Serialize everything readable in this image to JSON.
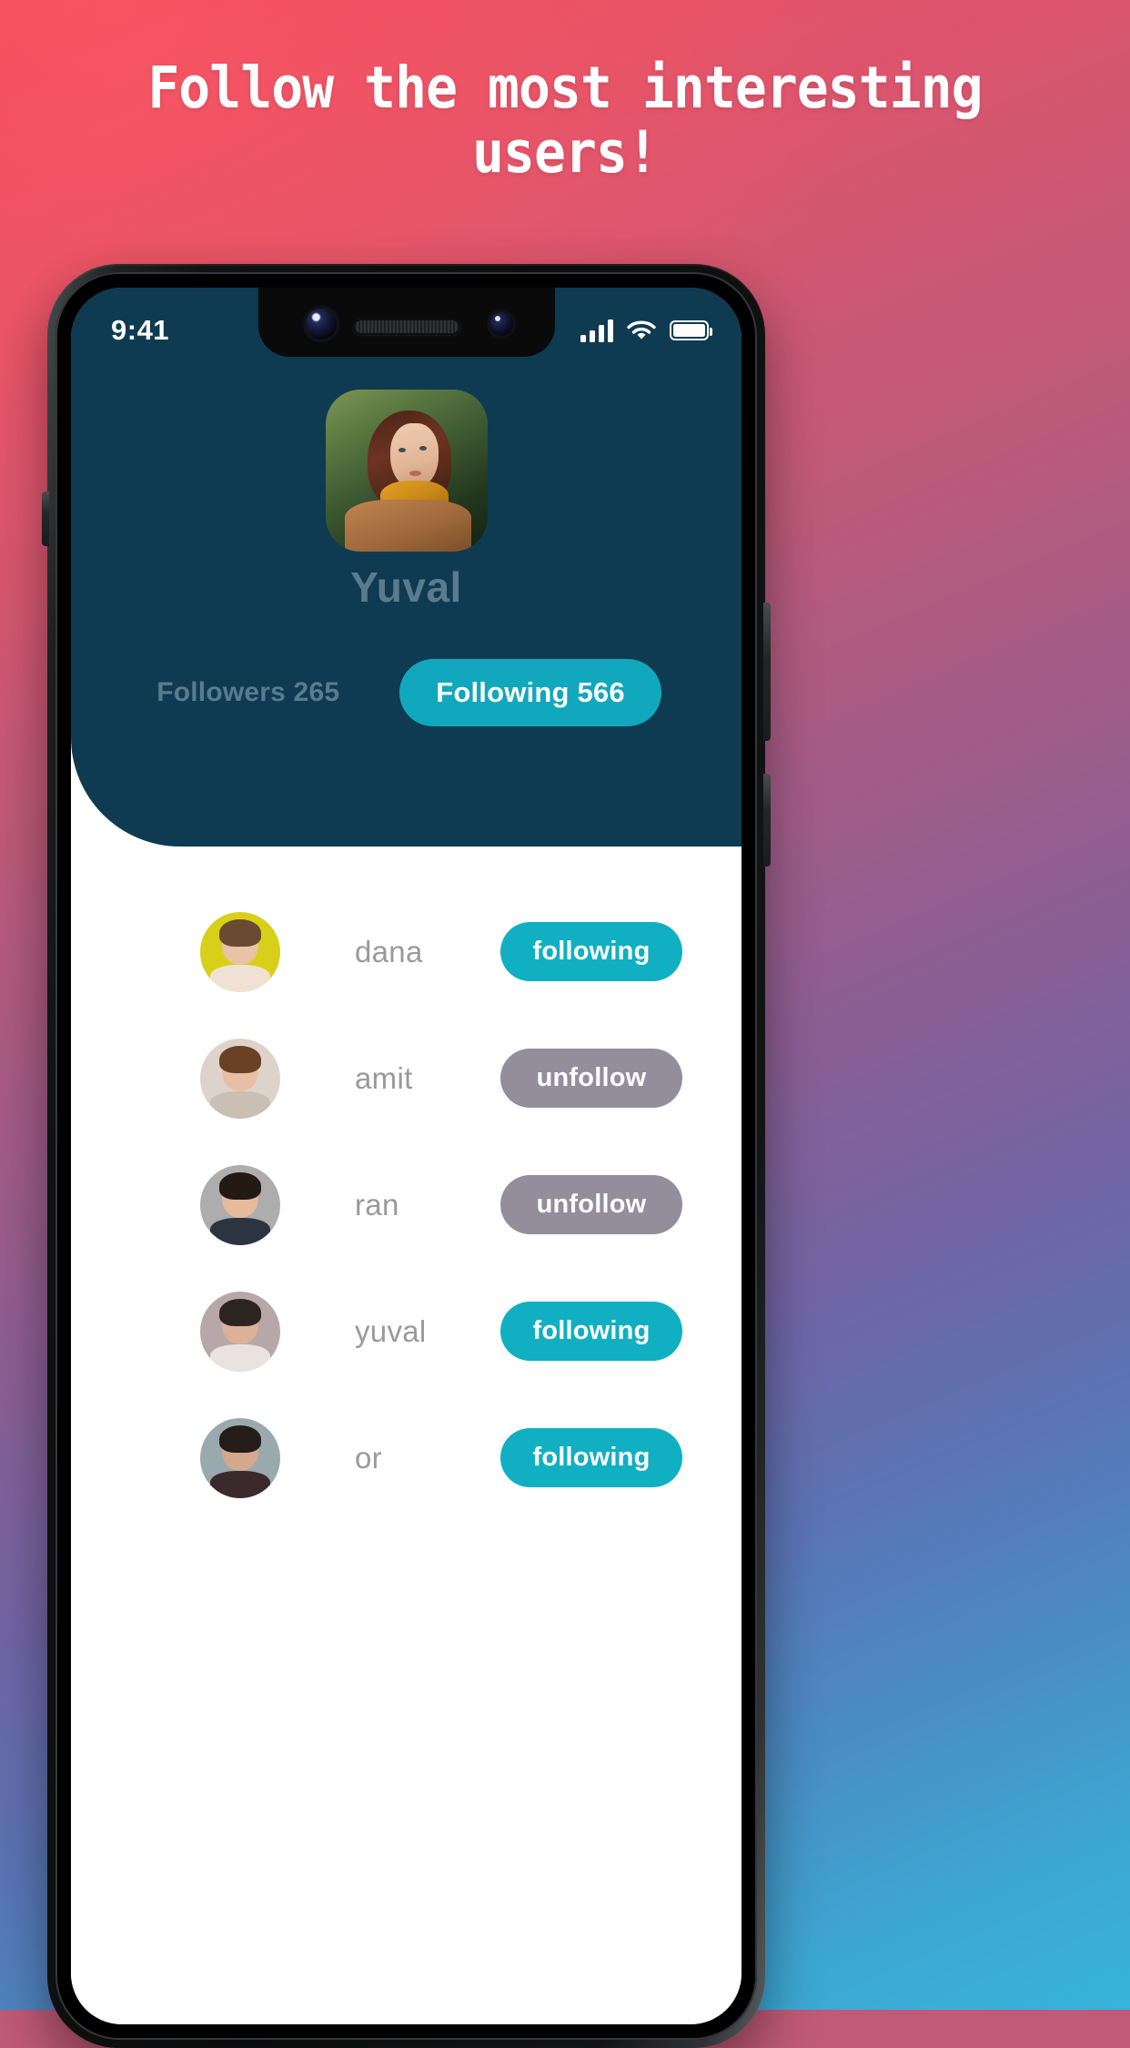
{
  "poster": {
    "headline": "Follow the most interesting\nusers!",
    "bg_start": "#ef4a5b",
    "bg_mid": "#8a5f95",
    "bg_end": "#37b4dc"
  },
  "status_bar": {
    "time": "9:41",
    "cellular_icon": "signal-bars-icon",
    "wifi_icon": "wifi-icon",
    "battery_icon": "battery-full-icon"
  },
  "app": {
    "header_color": "#0E3B52",
    "accent_color": "#11AFC2",
    "muted_color": "#938D9C",
    "profile": {
      "avatar_alt": "yuval-profile-photo",
      "name": "Yuval"
    },
    "tabs": [
      {
        "id": "followers",
        "label": "Followers 265",
        "active": false
      },
      {
        "id": "following",
        "label": "Following 566",
        "active": true
      }
    ],
    "users": [
      {
        "name": "dana",
        "action": "following",
        "state": "following",
        "skin": "#e8c3a6",
        "hair": "#6a4a33",
        "body": "#efe2d4",
        "bg": "#d8cf18"
      },
      {
        "name": "amit",
        "action": "unfollow",
        "state": "unfollow",
        "skin": "#e7bfa4",
        "hair": "#6b4125",
        "body": "#c9bfb3",
        "bg": "#ddd3cb"
      },
      {
        "name": "ran",
        "action": "unfollow",
        "state": "unfollow",
        "skin": "#e5bb9c",
        "hair": "#241a14",
        "body": "#2b3440",
        "bg": "#adadad"
      },
      {
        "name": "yuval",
        "action": "following",
        "state": "following",
        "skin": "#dcb199",
        "hair": "#2c2420",
        "body": "#e8e2e0",
        "bg": "#b7a7a8"
      },
      {
        "name": "or",
        "action": "following",
        "state": "following",
        "skin": "#d3a98e",
        "hair": "#241d19",
        "body": "#3a2a2c",
        "bg": "#9aa9ae"
      }
    ]
  }
}
